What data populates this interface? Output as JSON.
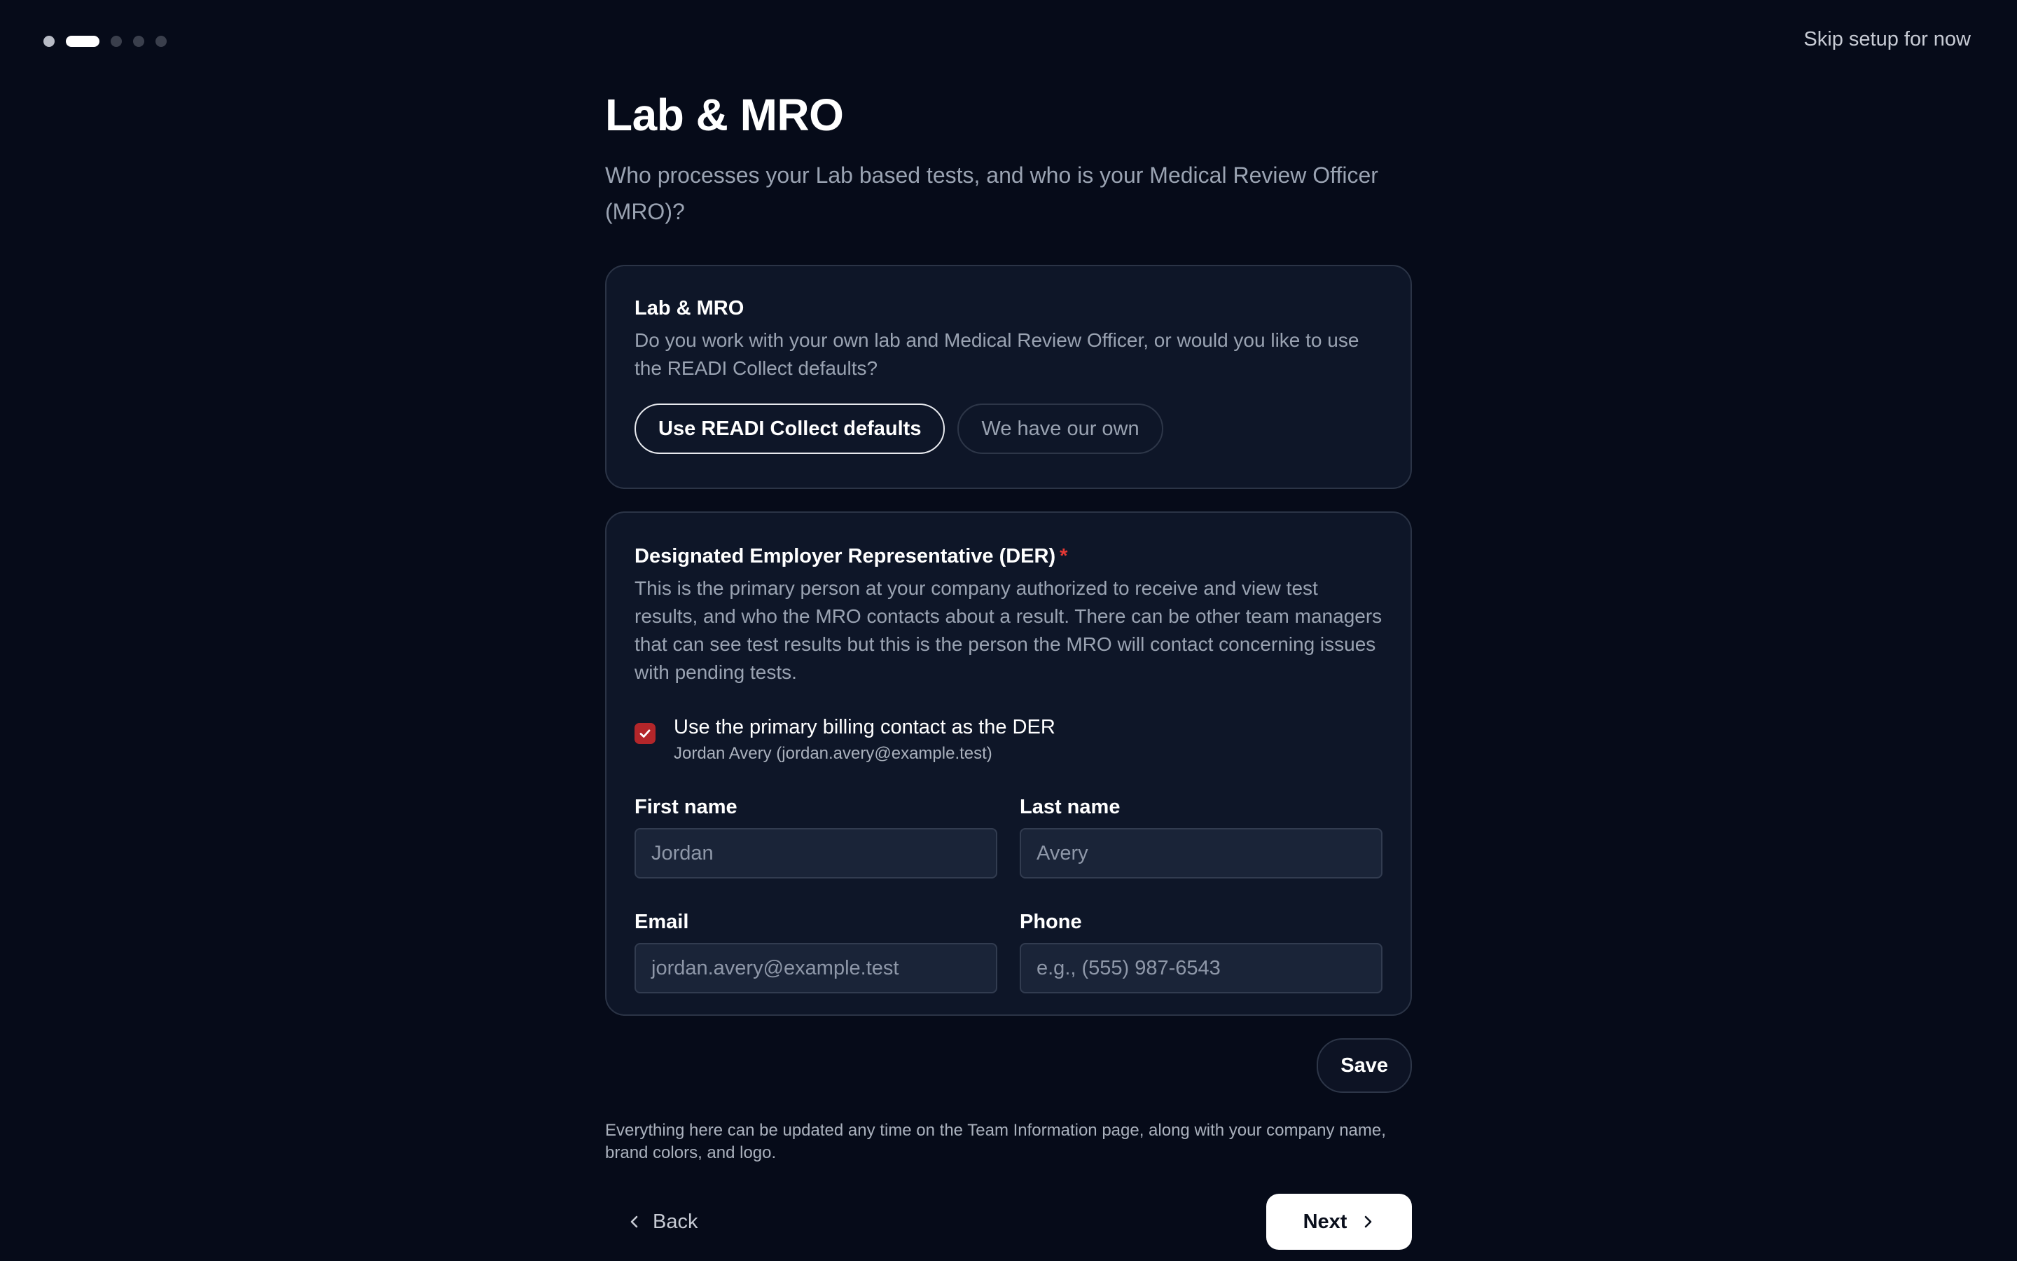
{
  "progress": {
    "total_steps": 5,
    "current_step": 2
  },
  "header": {
    "skip_label": "Skip setup for now"
  },
  "page": {
    "title": "Lab & MRO",
    "subtitle": "Who processes your Lab based tests, and who is your Medical Review Officer (MRO)?"
  },
  "lab_card": {
    "title": "Lab & MRO",
    "description": "Do you work with your own lab and Medical Review Officer, or would you like to use the READI Collect defaults?",
    "options": [
      {
        "label": "Use READI Collect defaults",
        "selected": true
      },
      {
        "label": "We have our own",
        "selected": false
      }
    ]
  },
  "der_card": {
    "title": "Designated Employer Representative (DER)",
    "required_mark": "*",
    "description": "This is the primary person at your company authorized to receive and view test results, and who the MRO contacts about a result. There can be other team managers that can see test results but this is the person the MRO will contact concerning issues with pending tests.",
    "checkbox": {
      "label": "Use the primary billing contact as the DER",
      "sublabel": "Jordan Avery (jordan.avery@example.test)",
      "checked": true
    },
    "fields": {
      "first_name": {
        "label": "First name",
        "value": "Jordan"
      },
      "last_name": {
        "label": "Last name",
        "value": "Avery"
      },
      "email": {
        "label": "Email",
        "value": "jordan.avery@example.test"
      },
      "phone": {
        "label": "Phone",
        "placeholder": "e.g., (555) 987-6543"
      }
    }
  },
  "actions": {
    "save_label": "Save",
    "back_label": "Back",
    "next_label": "Next"
  },
  "footnote": "Everything here can be updated any time on the Team Information page, along with your company name, brand colors, and logo.",
  "colors": {
    "background": "#060b19",
    "card": "#0e1628",
    "accent_red": "#b3262a",
    "text_muted": "#9aa3b2"
  }
}
